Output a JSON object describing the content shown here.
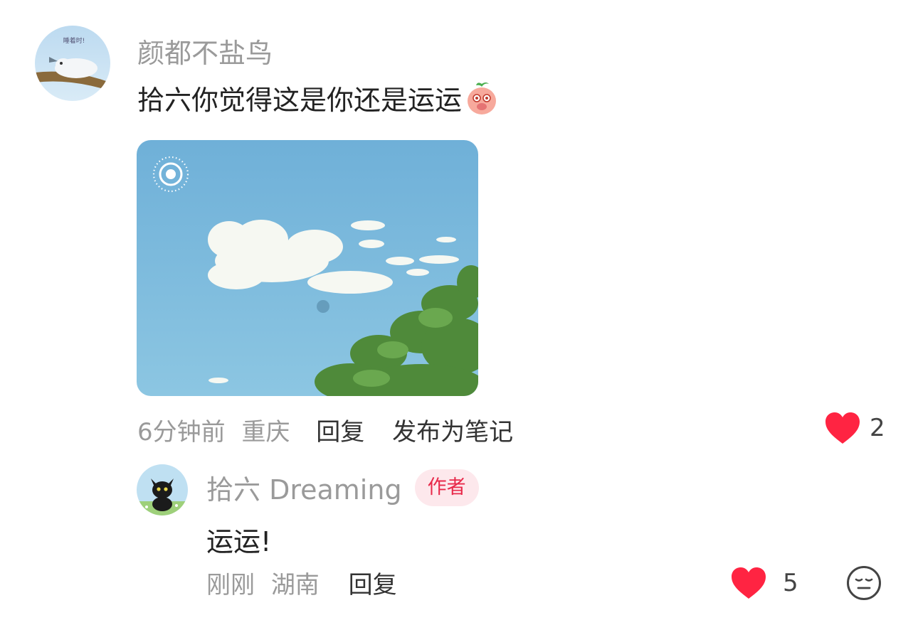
{
  "comment": {
    "username": "颜都不盐鸟",
    "avatar_icon": "seal-on-branch-avatar",
    "avatar_caption": "睡着时!",
    "text": "拾六你觉得这是你还是运运",
    "emoji_icon": "shy-peach-emoji",
    "image": {
      "alt": "sky-with-cloud-photo",
      "badge_icon": "live-photo-icon"
    },
    "time": "6分钟前",
    "location": "重庆",
    "reply_label": "回复",
    "publish_label": "发布为笔记",
    "like_count": "2",
    "like_color": "#ff2442"
  },
  "reply": {
    "username": "拾六 Dreaming",
    "avatar_icon": "black-cat-avatar",
    "author_badge": "作者",
    "text": "运运!",
    "time": "刚刚",
    "location": "湖南",
    "reply_label": "回复",
    "like_count": "5",
    "like_color": "#ff2442",
    "extra_icon": "neutral-face-icon"
  }
}
